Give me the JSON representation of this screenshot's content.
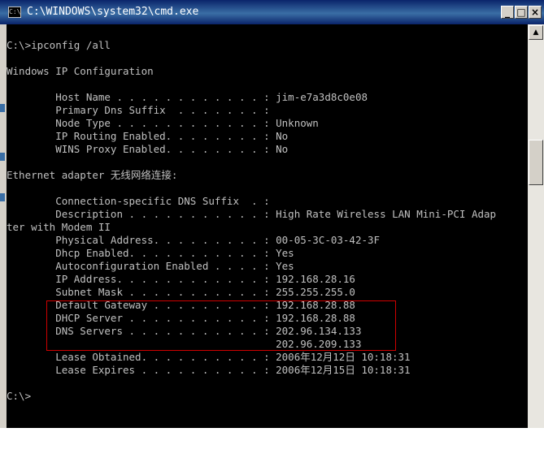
{
  "window": {
    "title": "C:\\WINDOWS\\system32\\cmd.exe",
    "icon_label": "C:\\",
    "minimize_glyph": "_",
    "maximize_glyph": "□",
    "close_glyph": "×"
  },
  "console": {
    "lines": [
      "C:\\>ipconfig /all",
      "",
      "Windows IP Configuration",
      "",
      "        Host Name . . . . . . . . . . . . : jim-e7a3d8c0e08",
      "        Primary Dns Suffix  . . . . . . . :",
      "        Node Type . . . . . . . . . . . . : Unknown",
      "        IP Routing Enabled. . . . . . . . : No",
      "        WINS Proxy Enabled. . . . . . . . : No",
      "",
      "Ethernet adapter 无线网络连接:",
      "",
      "        Connection-specific DNS Suffix  . :",
      "        Description . . . . . . . . . . . : High Rate Wireless LAN Mini-PCI Adap",
      "ter with Modem II",
      "        Physical Address. . . . . . . . . : 00-05-3C-03-42-3F",
      "        Dhcp Enabled. . . . . . . . . . . : Yes",
      "        Autoconfiguration Enabled . . . . : Yes",
      "        IP Address. . . . . . . . . . . . : 192.168.28.16",
      "        Subnet Mask . . . . . . . . . . . : 255.255.255.0",
      "        Default Gateway . . . . . . . . . : 192.168.28.88",
      "        DHCP Server . . . . . . . . . . . : 192.168.28.88",
      "        DNS Servers . . . . . . . . . . . : 202.96.134.133",
      "                                            202.96.209.133",
      "        Lease Obtained. . . . . . . . . . : 2006年12月12日 10:18:31",
      "        Lease Expires . . . . . . . . . . : 2006年12月15日 10:18:31",
      "",
      "C:\\>"
    ]
  },
  "colors": {
    "console_bg": "#000000",
    "console_text": "#c0c0c0",
    "title_bar": "#0a246a",
    "highlight_border": "#d00000"
  },
  "scrollbar": {
    "up_glyph": "▲"
  }
}
